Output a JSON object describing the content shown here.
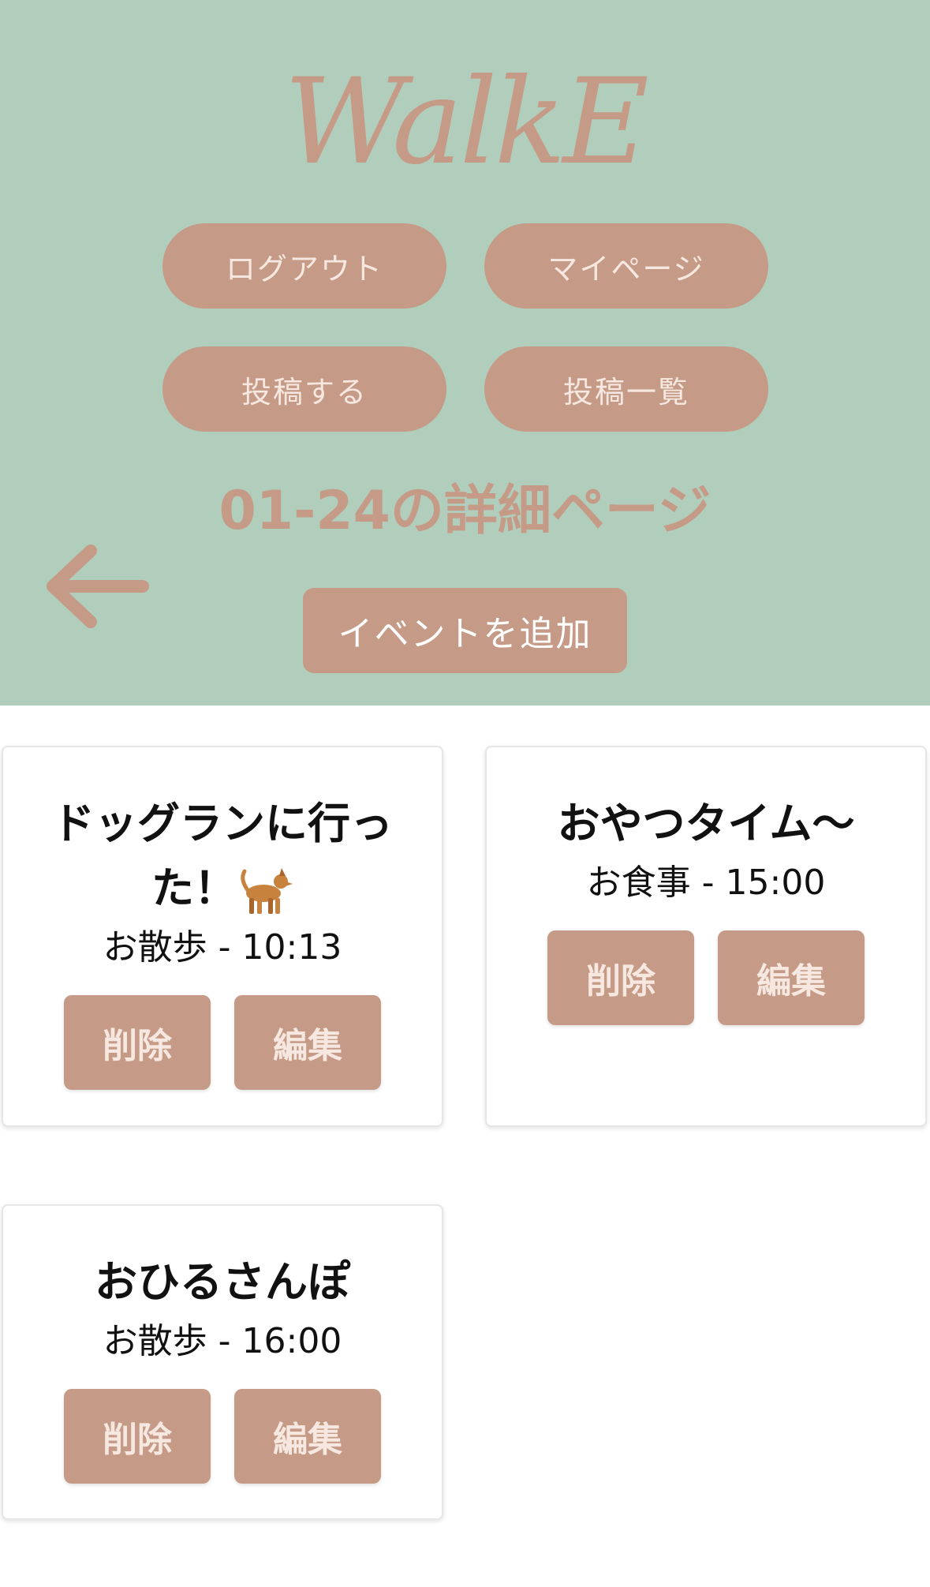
{
  "app": {
    "logo": "WalkE"
  },
  "nav": {
    "logout": "ログアウト",
    "mypage": "マイページ",
    "post": "投稿する",
    "post_list": "投稿一覧"
  },
  "page": {
    "title": "01-24の詳細ページ",
    "add_event": "イベントを追加",
    "back_icon": "arrow-left-icon"
  },
  "events": [
    {
      "title": "ドッグランに行った！",
      "title_icon": "dog-icon",
      "subtitle": "お散歩 - 10:13",
      "delete_label": "削除",
      "edit_label": "編集"
    },
    {
      "title": "おやつタイム〜",
      "subtitle": "お食事 - 15:00",
      "delete_label": "削除",
      "edit_label": "編集"
    },
    {
      "title": "おひるさんぽ",
      "subtitle": "お散歩 - 16:00",
      "delete_label": "削除",
      "edit_label": "編集"
    }
  ],
  "colors": {
    "header_bg": "#b1cebd",
    "accent": "#c59b87",
    "button_text": "#f6e8e0"
  }
}
